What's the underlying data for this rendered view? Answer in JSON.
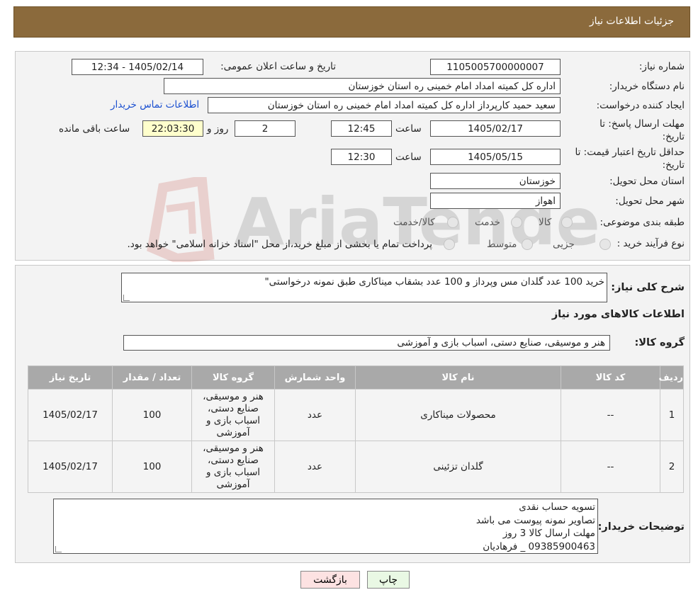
{
  "header": {
    "title": "جزئیات اطلاعات نیاز"
  },
  "form": {
    "need_number_label": "شماره نیاز:",
    "need_number": "1105005700000007",
    "announce_label": "تاریخ و ساعت اعلان عمومی:",
    "announce_value": "1405/02/14 - 12:34",
    "buyer_org_label": "نام دستگاه خریدار:",
    "buyer_org": "اداره کل کمیته امداد امام خمینی  ره  استان خوزستان",
    "creator_label": "ایجاد کننده درخواست:",
    "creator": "سعید حمید کارپرداز اداره کل کمیته امداد امام خمینی  ره  استان خوزستان",
    "contact_link": "اطلاعات تماس خریدار",
    "deadline_label": "مهلت ارسال پاسخ: تا تاریخ:",
    "deadline_date": "1405/02/17",
    "time_label": "ساعت",
    "deadline_time": "12:45",
    "days_value": "2",
    "days_label": "روز و",
    "remaining_time": "22:03:30",
    "remaining_label": "ساعت باقی مانده",
    "validity_label": "حداقل تاریخ اعتبار قیمت: تا تاریخ:",
    "validity_date": "1405/05/15",
    "validity_time_label": "ساعت",
    "validity_time": "12:30",
    "province_label": "استان محل تحویل:",
    "province": "خوزستان",
    "city_label": "شهر محل تحویل:",
    "city": "اهواز",
    "category_label": "طبقه بندی موضوعی:",
    "category_options": [
      "کالا",
      "خدمت",
      "کالا/خدمت"
    ],
    "process_label": "نوع فرآیند خرید :",
    "process_options": [
      "جزیی",
      "متوسط"
    ],
    "process_note": "پرداخت تمام یا بخشی از مبلغ خرید،از محل \"اسناد خزانه اسلامی\" خواهد بود."
  },
  "details": {
    "summary_label": "شرح کلی نیاز:",
    "summary": "خرید 100 عدد گلدان مس وپرداز و 100 عدد بشقاب میناکاری طبق نمونه درخواستی\"",
    "goods_info_title": "اطلاعات کالاهای مورد نیاز",
    "goods_group_label": "گروه کالا:",
    "goods_group": "هنر و موسیقی، صنایع دستی، اسباب بازی و آموزشی"
  },
  "table": {
    "headers": [
      "ردیف",
      "کد کالا",
      "نام کالا",
      "واحد شمارش",
      "گروه کالا",
      "تعداد / مقدار",
      "تاریخ نیاز"
    ],
    "rows": [
      [
        "1",
        "--",
        "محصولات میناکاری",
        "عدد",
        "هنر و موسیقی، صنایع دستی، اسباب بازی و آموزشی",
        "100",
        "1405/02/17"
      ],
      [
        "2",
        "--",
        "گلدان تزئینی",
        "عدد",
        "هنر و موسیقی، صنایع دستی، اسباب بازی و آموزشی",
        "100",
        "1405/02/17"
      ]
    ]
  },
  "buyer_notes": {
    "label": "توضیحات خریدار:",
    "lines": [
      "تسویه حساب نقدی",
      "تصاویر نمونه پیوست می باشد",
      "مهلت ارسال کالا 3 روز",
      "09385900463 _ فرهادیان"
    ]
  },
  "buttons": {
    "print": "چاپ",
    "back": "بازگشت"
  },
  "colors": {
    "header_bg": "#8b6a3c",
    "back_button_bg": "#fde2e2",
    "print_button_bg": "#e9f8e4",
    "remaining_bg": "#ffffcc",
    "link": "#1a4fd0"
  }
}
